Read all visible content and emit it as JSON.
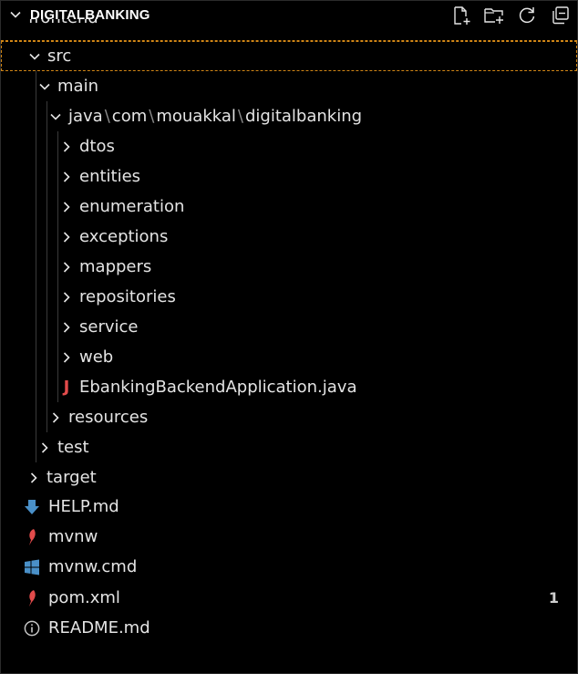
{
  "explorer": {
    "title": "DIGITALBANKING",
    "actions": [
      {
        "name": "new-file",
        "icon": "new-file-icon"
      },
      {
        "name": "new-folder",
        "icon": "new-folder-icon"
      },
      {
        "name": "refresh",
        "icon": "refresh-icon"
      },
      {
        "name": "collapse-all",
        "icon": "collapse-all-icon"
      }
    ],
    "peek_label": "frontend"
  },
  "tree": {
    "src": "src",
    "main": "main",
    "java_path": [
      "java",
      "com",
      "mouakkal",
      "digitalbanking"
    ],
    "packages": [
      "dtos",
      "entities",
      "enumeration",
      "exceptions",
      "mappers",
      "repositories",
      "service",
      "web"
    ],
    "app_file": "EbankingBackendApplication.java",
    "java_icon_glyph": "J",
    "resources": "resources",
    "test": "test",
    "target": "target",
    "root_files": [
      {
        "label": "HELP.md",
        "icon": "download-icon"
      },
      {
        "label": "mvnw",
        "icon": "maven-icon"
      },
      {
        "label": "mvnw.cmd",
        "icon": "windows-icon"
      },
      {
        "label": "pom.xml",
        "icon": "maven-icon",
        "badge": "1"
      },
      {
        "label": "README.md",
        "icon": "info-icon"
      }
    ]
  },
  "colors": {
    "background": "#000000",
    "text": "#e4e4e4",
    "focus_border": "#d18616",
    "java": "#e24b4b",
    "maven": "#e24b4b",
    "windows": "#4a90c8",
    "download": "#4a90c8",
    "info": "#c5c5c5"
  }
}
